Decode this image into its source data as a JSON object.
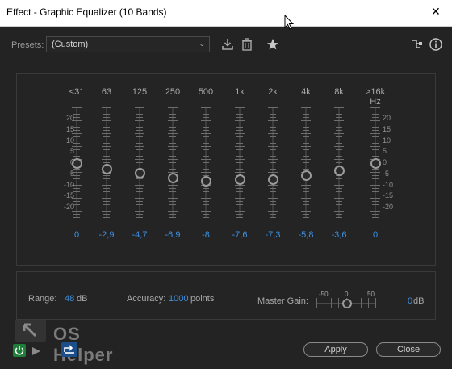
{
  "window": {
    "title": "Effect - Graphic Equalizer (10 Bands)"
  },
  "presets": {
    "label": "Presets:",
    "value": "(Custom)"
  },
  "bands": [
    {
      "freq": "<31",
      "gain": "0",
      "gain_db": 0
    },
    {
      "freq": "63",
      "gain": "-2,9",
      "gain_db": -2.9
    },
    {
      "freq": "125",
      "gain": "-4,7",
      "gain_db": -4.7
    },
    {
      "freq": "250",
      "gain": "-6,9",
      "gain_db": -6.9
    },
    {
      "freq": "500",
      "gain": "-8",
      "gain_db": -8
    },
    {
      "freq": "1k",
      "gain": "-7,6",
      "gain_db": -7.6
    },
    {
      "freq": "2k",
      "gain": "-7,3",
      "gain_db": -7.3
    },
    {
      "freq": "4k",
      "gain": "-5,8",
      "gain_db": -5.8
    },
    {
      "freq": "8k",
      "gain": "-3,6",
      "gain_db": -3.6
    },
    {
      "freq": ">16k Hz",
      "gain": "0",
      "gain_db": 0
    }
  ],
  "scale_labels": [
    "20",
    "15",
    "10",
    "5",
    "0",
    "-5",
    "-10",
    "-15",
    "-20"
  ],
  "range": {
    "label": "Range:",
    "value": "48",
    "unit": "dB"
  },
  "accuracy": {
    "label": "Accuracy:",
    "value": "1000",
    "unit": "points"
  },
  "master_gain": {
    "label": "Master Gain:",
    "scale_min": "-50",
    "scale_mid": "0",
    "scale_max": "50",
    "value": "0",
    "unit": "dB"
  },
  "buttons": {
    "apply": "Apply",
    "close": "Close"
  },
  "watermark": {
    "text": "OS Helper"
  },
  "colors": {
    "accent": "#3d8fe0",
    "background": "#232323"
  }
}
